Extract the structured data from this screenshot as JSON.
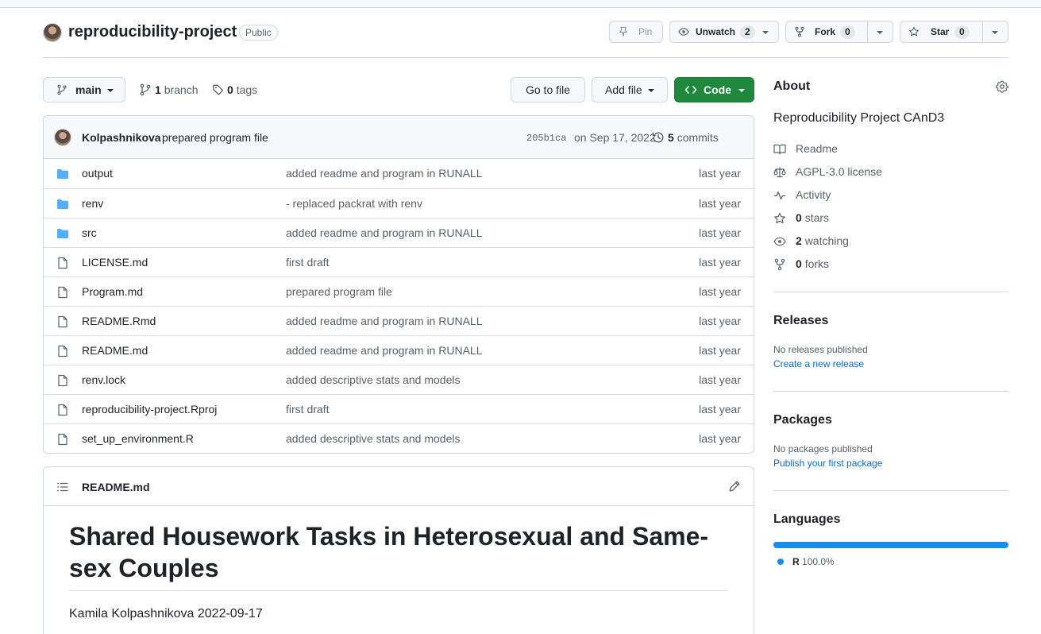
{
  "repo": {
    "name": "reproducibility-project",
    "visibility": "Public",
    "pin_label": "Pin",
    "unwatch_label": "Unwatch",
    "watch_count": "2",
    "fork_label": "Fork",
    "fork_count": "0",
    "star_label": "Star",
    "star_count": "0"
  },
  "toolbar": {
    "branch": "main",
    "branches_count": "1",
    "branches_label": "branch",
    "tags_count": "0",
    "tags_label": "tags",
    "go_to_file": "Go to file",
    "add_file": "Add file",
    "code": "Code"
  },
  "latest_commit": {
    "author": "Kolpashnikova",
    "message": "prepared program file",
    "sha": "205b1ca",
    "date": "on Sep 17, 2022",
    "commits_count": "5",
    "commits_label": "commits"
  },
  "files": [
    {
      "type": "dir",
      "name": "output",
      "message": "added readme and program in RUNALL",
      "age": "last year"
    },
    {
      "type": "dir",
      "name": "renv",
      "message": "- replaced packrat with renv",
      "age": "last year"
    },
    {
      "type": "dir",
      "name": "src",
      "message": "added readme and program in RUNALL",
      "age": "last year"
    },
    {
      "type": "file",
      "name": "LICENSE.md",
      "message": "first draft",
      "age": "last year"
    },
    {
      "type": "file",
      "name": "Program.md",
      "message": "prepared program file",
      "age": "last year"
    },
    {
      "type": "file",
      "name": "README.Rmd",
      "message": "added readme and program in RUNALL",
      "age": "last year"
    },
    {
      "type": "file",
      "name": "README.md",
      "message": "added readme and program in RUNALL",
      "age": "last year"
    },
    {
      "type": "file",
      "name": "renv.lock",
      "message": "added descriptive stats and models",
      "age": "last year"
    },
    {
      "type": "file",
      "name": "reproducibility-project.Rproj",
      "message": "first draft",
      "age": "last year"
    },
    {
      "type": "file",
      "name": "set_up_environment.R",
      "message": "added descriptive stats and models",
      "age": "last year"
    }
  ],
  "readme": {
    "filename": "README.md",
    "heading": "Shared Housework Tasks in Heterosexual and Same-sex Couples",
    "byline": "Kamila Kolpashnikova 2022-09-17"
  },
  "about": {
    "title": "About",
    "description": "Reproducibility Project CAnD3",
    "readme": "Readme",
    "license": "AGPL-3.0 license",
    "activity": "Activity",
    "stars_count": "0",
    "stars_label": "stars",
    "watching_count": "2",
    "watching_label": "watching",
    "forks_count": "0",
    "forks_label": "forks"
  },
  "releases": {
    "title": "Releases",
    "empty": "No releases published",
    "link": "Create a new release"
  },
  "packages": {
    "title": "Packages",
    "empty": "No packages published",
    "link": "Publish your first package"
  },
  "languages": {
    "title": "Languages",
    "items": [
      {
        "name": "R",
        "percent": "100.0%",
        "share": 1.0,
        "color": "#198CE7"
      }
    ]
  },
  "colors": {
    "code_button": "#1f883d",
    "folder_icon": "#54aeff",
    "link": "#0969da"
  }
}
